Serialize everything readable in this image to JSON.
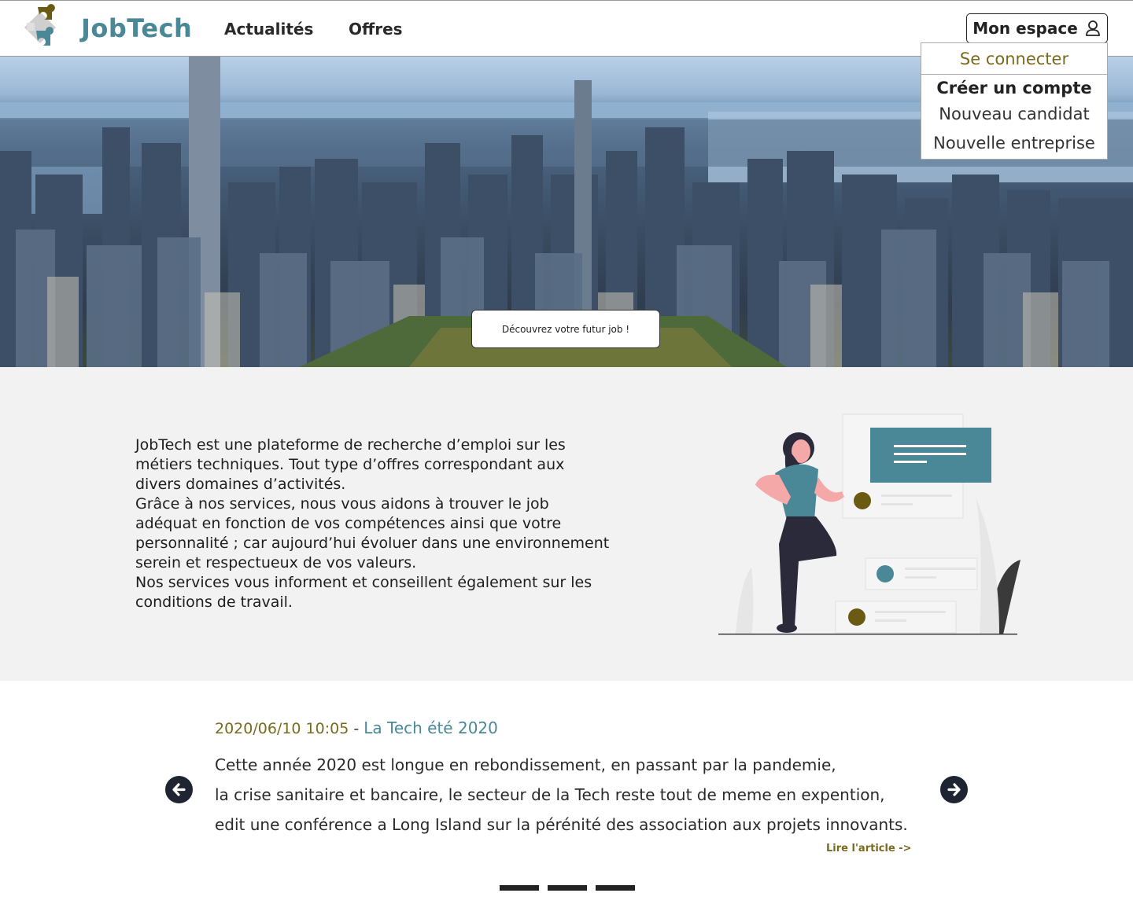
{
  "header": {
    "brand": "JobTech",
    "nav": {
      "news": "Actualités",
      "offers": "Offres"
    },
    "account_button": "Mon espace"
  },
  "account_menu": {
    "login": "Se connecter",
    "create_heading": "Créer un compte",
    "new_candidate": "Nouveau candidat",
    "new_company": "Nouvelle entreprise"
  },
  "hero": {
    "cta": "Découvrez votre futur job !"
  },
  "about": {
    "text": "JobTech est une plateforme de recherche d’emploi sur les\nmétiers techniques. Tout type d’offres correspondant aux\ndivers domaines d’activités.\nGrâce à nos services, nous vous aidons à trouver le job\nadéquat en fonction de vos compétences ainsi que votre\n personnalité ; car aujourd’hui évoluer dans une environnement\nserein et respectueux de vos valeurs.\nNos services vous informent et conseillent également sur les\nconditions de travail."
  },
  "news": {
    "date": "2020/06/10 10:05",
    "separator": " - ",
    "title": "La Tech été 2020",
    "body": "Cette année 2020 est longue en rebondissement, en passant par la pandemie,\nla crise sanitaire et bancaire, le secteur de la Tech reste tout de meme en expention,\nedit une conférence a Long Island sur la pérénité des association aux projets innovants.",
    "read_more": "Lire l'article ->"
  },
  "colors": {
    "brand_teal": "#4a8797",
    "accent_olive": "#7a6a1e",
    "dark_navy": "#1f2433",
    "section_grey": "#f2f2f2"
  },
  "icons": {
    "logo": "puzzle-logo-icon",
    "account": "user-icon",
    "prev": "arrow-left-circle-icon",
    "next": "arrow-right-circle-icon"
  }
}
